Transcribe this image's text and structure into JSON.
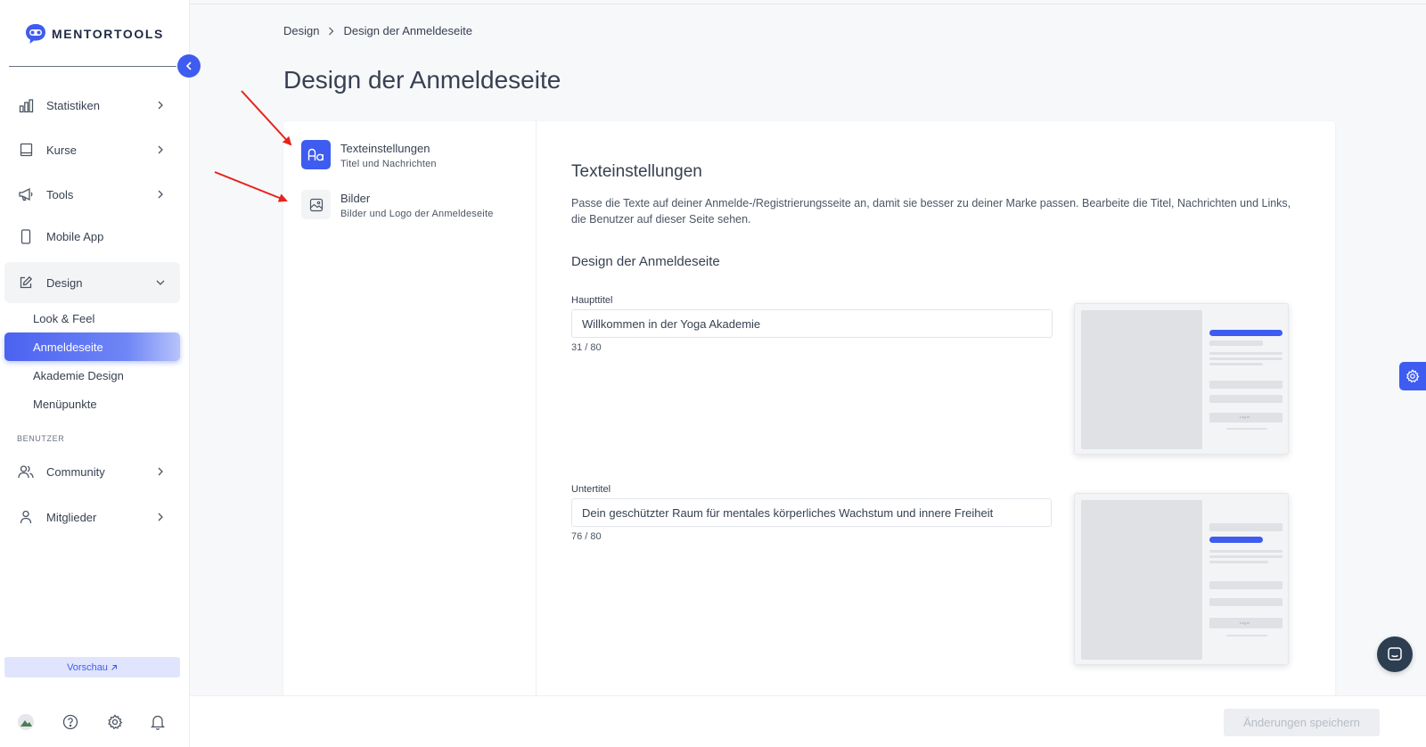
{
  "brand": {
    "name": "MENTORTOOLS",
    "accent": "#3f5cf0",
    "annotation_color": "#e8231a"
  },
  "sidebar": {
    "nav": [
      {
        "label": "Statistiken",
        "icon": "bar-chart-icon",
        "has_chevron": true
      },
      {
        "label": "Kurse",
        "icon": "book-icon",
        "has_chevron": true
      },
      {
        "label": "Tools",
        "icon": "megaphone-icon",
        "has_chevron": true
      },
      {
        "label": "Mobile App",
        "icon": "phone-icon",
        "has_chevron": false
      },
      {
        "label": "Design",
        "icon": "pencil-edit-icon",
        "has_chevron": true,
        "expanded": true
      }
    ],
    "design_sub": [
      {
        "label": "Look & Feel",
        "active": false
      },
      {
        "label": "Anmeldeseite",
        "active": true
      },
      {
        "label": "Akademie Design",
        "active": false
      },
      {
        "label": "Menüpunkte",
        "active": false
      }
    ],
    "users_section_label": "BENUTZER",
    "user_nav": [
      {
        "label": "Community",
        "icon": "users-icon"
      },
      {
        "label": "Mitglieder",
        "icon": "user-icon"
      }
    ],
    "preview_label": "Vorschau"
  },
  "breadcrumb": {
    "parent": "Design",
    "current": "Design der Anmeldeseite"
  },
  "page_title": "Design der Anmeldeseite",
  "settings_tabs": [
    {
      "title": "Texteinstellungen",
      "subtitle": "Titel und Nachrichten",
      "icon": "text-format-icon",
      "active": true
    },
    {
      "title": "Bilder",
      "subtitle": "Bilder und Logo der Anmeldeseite",
      "icon": "image-icon",
      "active": false
    }
  ],
  "content": {
    "section_title": "Texteinstellungen",
    "description": "Passe die Texte auf deiner Anmelde-/Registrierungsseite an, damit sie besser zu deiner Marke passen. Bearbeite die Titel, Nachrichten und Links, die Benutzer auf dieser Seite sehen.",
    "subsection_title": "Design der Anmeldeseite",
    "fields": [
      {
        "label": "Haupttitel",
        "value": "Willkommen in der Yoga Akademie",
        "counter": "31 / 80"
      },
      {
        "label": "Untertitel",
        "value": "Dein geschützter Raum für mentales körperliches Wachstum und innere Freiheit",
        "counter": "76 / 80"
      }
    ],
    "thumbnail_button_text": "Log in"
  },
  "footer": {
    "save_label": "Änderungen speichern"
  }
}
